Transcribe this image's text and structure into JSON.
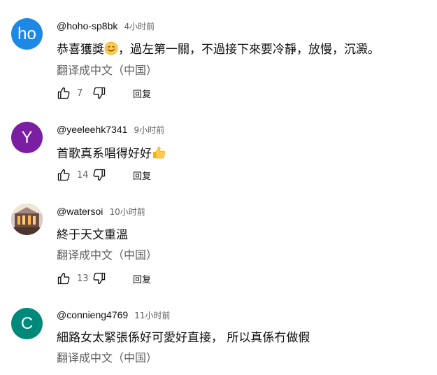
{
  "comments": [
    {
      "avatar_text": "ho",
      "avatar_color": "#1e88e5",
      "author": "@hoho-sp8bk",
      "time": "4小时前",
      "text": "恭喜獲獎",
      "text_after_emoji": "，過左第一關，不過接下來要冷靜，放慢，沉澱。",
      "emoji": "smiling-face-emoji",
      "translate": "翻译成中文（中国）",
      "likes": "7",
      "reply": "回复"
    },
    {
      "avatar_text": "Y",
      "avatar_color": "#7b1fa2",
      "author": "@yeeleehk7341",
      "time": "9小时前",
      "text": "首歌真系唱得好好",
      "emoji": "thumbs-up-emoji",
      "likes": "14",
      "reply": "回复"
    },
    {
      "avatar_text": "",
      "avatar_color": "#8d6e63",
      "author": "@watersoi",
      "time": "10小时前",
      "text": "終于天文重溫",
      "translate": "翻译成中文（中国）",
      "likes": "13",
      "reply": "回复"
    },
    {
      "avatar_text": "C",
      "avatar_color": "#00897b",
      "author": "@connieng4769",
      "time": "11小时前",
      "text": "細路女太緊張係好可愛好直接， 所以真係冇做假",
      "translate": "翻译成中文（中国）"
    }
  ]
}
